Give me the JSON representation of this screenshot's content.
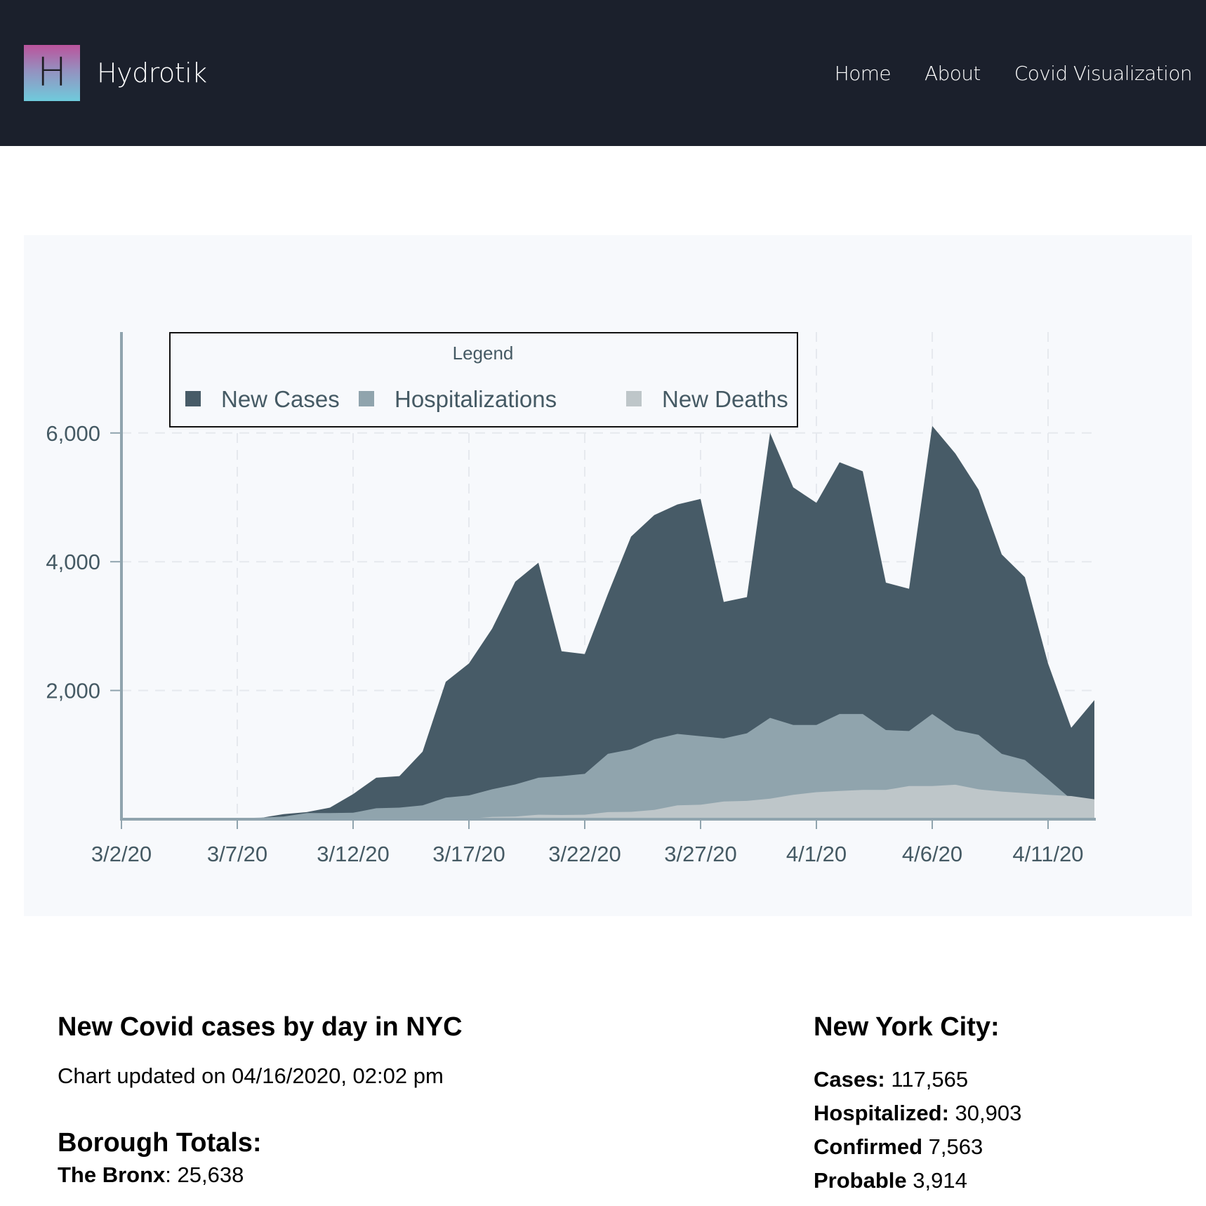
{
  "header": {
    "logo_letter": "H",
    "brand": "Hydrotik",
    "nav": [
      {
        "label": "Home"
      },
      {
        "label": "About"
      },
      {
        "label": "Covid Visualization"
      }
    ]
  },
  "colors": {
    "header_bg": "#1b202c",
    "new_cases": "#475b67",
    "hospitalizations": "#90a4ad",
    "new_deaths": "#bec6c9",
    "axis": "#90a4ae",
    "panel_bg": "#f7f9fc"
  },
  "chart_data": {
    "type": "area",
    "title": "",
    "legend_title": "Legend",
    "legend_position": "top-left",
    "xlabel": "",
    "ylabel": "",
    "ylim": [
      0,
      7500
    ],
    "grid": true,
    "y_ticks": [
      {
        "value": 2000,
        "label": "2,000"
      },
      {
        "value": 4000,
        "label": "4,000"
      },
      {
        "value": 6000,
        "label": "6,000"
      }
    ],
    "x_ticks": [
      {
        "index": 0,
        "label": "3/2/20"
      },
      {
        "index": 5,
        "label": "3/7/20"
      },
      {
        "index": 10,
        "label": "3/12/20"
      },
      {
        "index": 15,
        "label": "3/17/20"
      },
      {
        "index": 20,
        "label": "3/22/20"
      },
      {
        "index": 25,
        "label": "3/27/20"
      },
      {
        "index": 30,
        "label": "4/1/20"
      },
      {
        "index": 35,
        "label": "4/6/20"
      },
      {
        "index": 40,
        "label": "4/11/20"
      }
    ],
    "x": [
      "3/2/20",
      "3/3/20",
      "3/4/20",
      "3/5/20",
      "3/6/20",
      "3/7/20",
      "3/8/20",
      "3/9/20",
      "3/10/20",
      "3/11/20",
      "3/12/20",
      "3/13/20",
      "3/14/20",
      "3/15/20",
      "3/16/20",
      "3/17/20",
      "3/18/20",
      "3/19/20",
      "3/20/20",
      "3/21/20",
      "3/22/20",
      "3/23/20",
      "3/24/20",
      "3/25/20",
      "3/26/20",
      "3/27/20",
      "3/28/20",
      "3/29/20",
      "3/30/20",
      "3/31/20",
      "4/1/20",
      "4/2/20",
      "4/3/20",
      "4/4/20",
      "4/5/20",
      "4/6/20",
      "4/7/20",
      "4/8/20",
      "4/9/20",
      "4/10/20",
      "4/11/20",
      "4/12/20",
      "4/13/20"
    ],
    "series": [
      {
        "name": "New Cases",
        "values": [
          1,
          0,
          2,
          5,
          3,
          5,
          20,
          80,
          110,
          180,
          390,
          645,
          670,
          1050,
          2135,
          2420,
          2960,
          3690,
          3985,
          2610,
          2565,
          3500,
          4390,
          4725,
          4890,
          4975,
          3375,
          3450,
          6000,
          5155,
          4915,
          5545,
          5405,
          3675,
          3580,
          6110,
          5680,
          5120,
          4115,
          3760,
          2420,
          1420,
          1850
        ]
      },
      {
        "name": "Hospitalizations",
        "values": [
          5,
          5,
          8,
          8,
          10,
          15,
          25,
          40,
          95,
          95,
          100,
          170,
          180,
          215,
          335,
          370,
          465,
          540,
          645,
          670,
          705,
          1015,
          1085,
          1240,
          1325,
          1290,
          1255,
          1335,
          1575,
          1465,
          1465,
          1635,
          1635,
          1385,
          1370,
          1635,
          1385,
          1310,
          1015,
          920,
          620,
          310,
          300
        ]
      },
      {
        "name": "New Deaths",
        "values": [
          0,
          0,
          0,
          0,
          0,
          0,
          0,
          0,
          0,
          0,
          0,
          0,
          0,
          5,
          8,
          10,
          35,
          40,
          70,
          65,
          70,
          110,
          115,
          145,
          215,
          225,
          275,
          285,
          320,
          380,
          420,
          440,
          455,
          455,
          515,
          515,
          535,
          465,
          430,
          405,
          380,
          360,
          310
        ]
      }
    ]
  },
  "info": {
    "title": "New Covid cases by day in NYC",
    "updated": "Chart updated on 04/16/2020, 02:02 pm",
    "borough_heading": "Borough Totals:",
    "boroughs": [
      {
        "name": "The Bronx",
        "value": "25,638"
      }
    ]
  },
  "nyc": {
    "heading": "New York City:",
    "stats": [
      {
        "label": "Cases:",
        "value": "117,565"
      },
      {
        "label": "Hospitalized:",
        "value": "30,903"
      },
      {
        "label": "Confirmed",
        "value": "7,563"
      },
      {
        "label": "Probable",
        "value": "3,914"
      }
    ]
  }
}
